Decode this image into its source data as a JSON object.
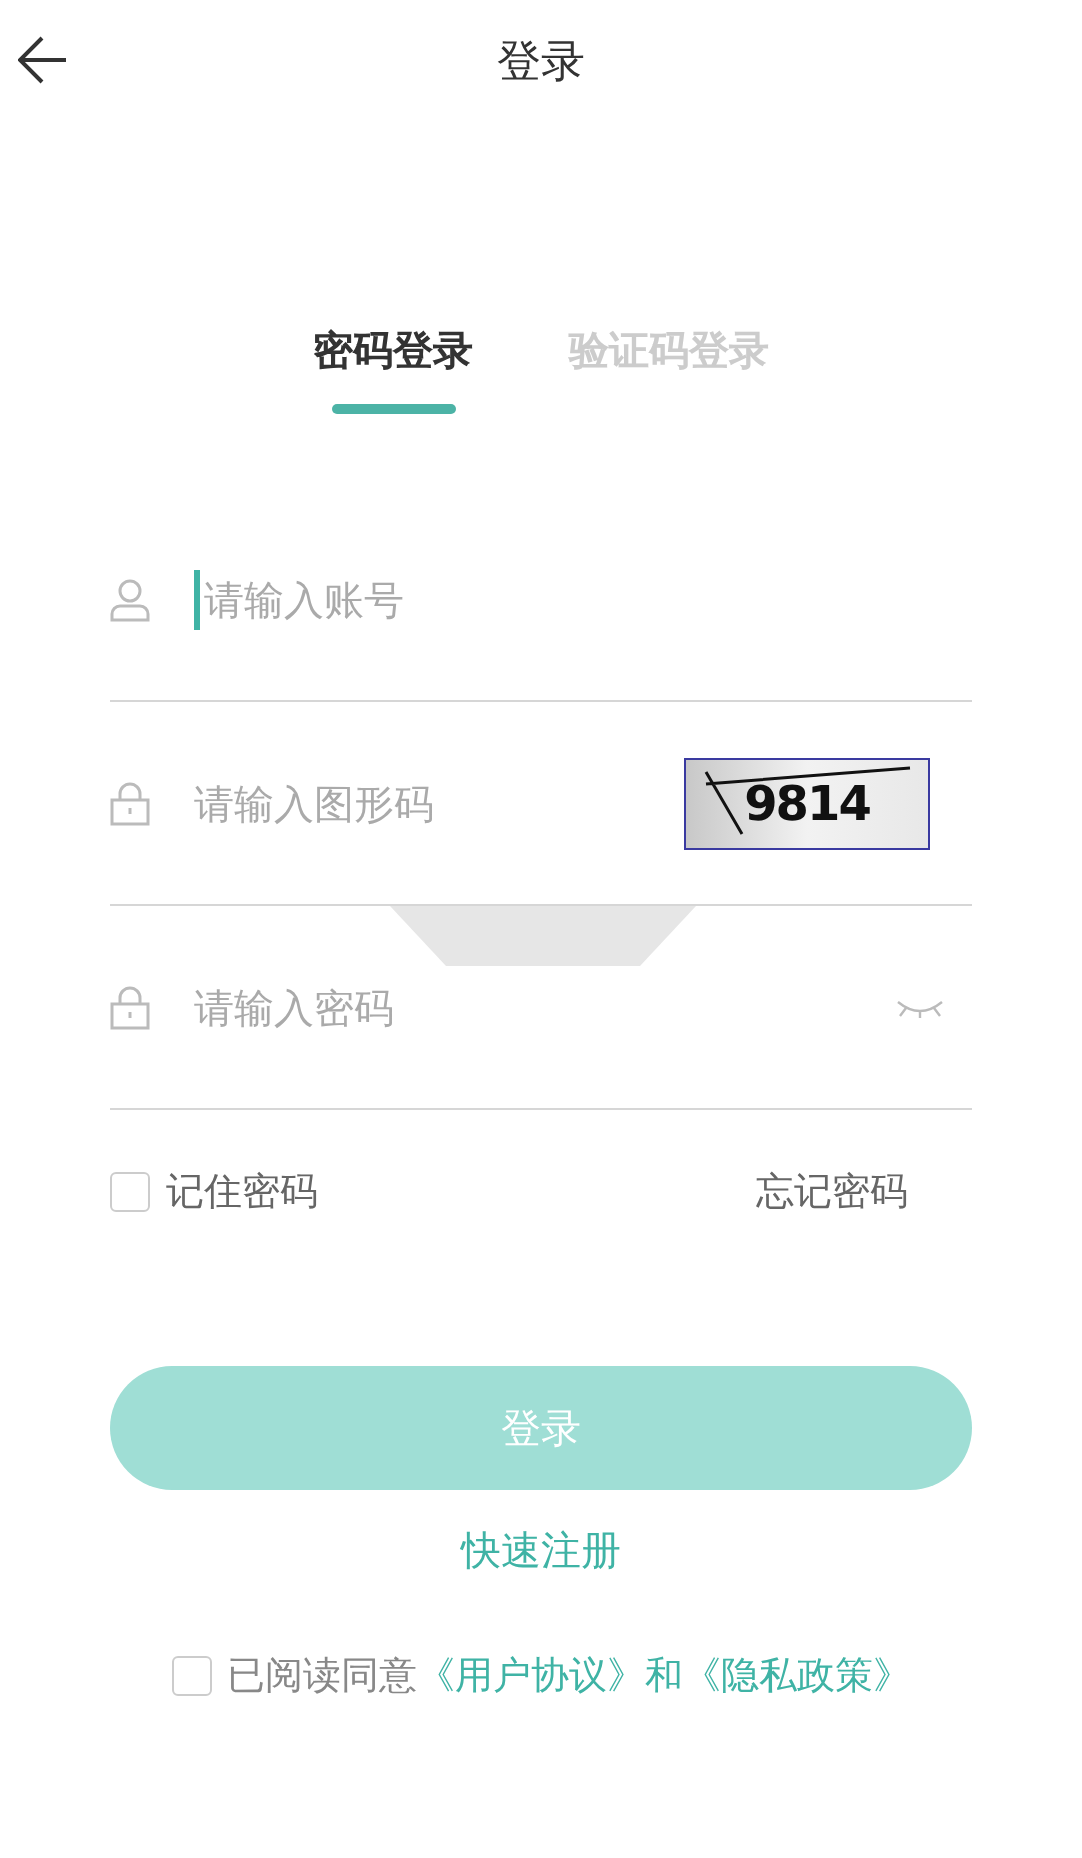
{
  "header": {
    "title": "登录"
  },
  "tabs": [
    {
      "label": "密码登录",
      "selected": true
    },
    {
      "label": "验证码登录",
      "selected": false
    }
  ],
  "fields": [
    {
      "kind": "account",
      "placeholder": "请输入账号",
      "focused": true
    },
    {
      "kind": "captcha",
      "placeholder": "请输入图形码",
      "captcha_text": "9814",
      "focused": false
    },
    {
      "kind": "password",
      "placeholder": "请输入密码",
      "focused": false
    }
  ],
  "remember": {
    "label": "记住密码",
    "checked": false
  },
  "forgot": "忘记密码",
  "login_button": {
    "label": "登录",
    "disabled": true
  },
  "register": "快速注册",
  "agreement": {
    "checked": false,
    "text": "已阅读同意",
    "link_1": "《用户协议》",
    "joiner": "和",
    "link_2": "《隐私政策》"
  }
}
